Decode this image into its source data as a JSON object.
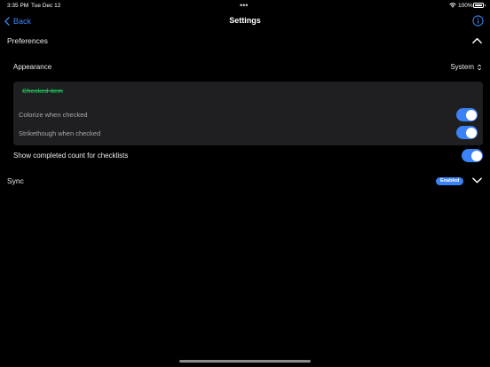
{
  "status_bar": {
    "time": "3:35 PM",
    "date": "Tue Dec 12",
    "battery": "100%"
  },
  "nav": {
    "back_label": "Back",
    "title": "Settings"
  },
  "preferences": {
    "header": "Preferences",
    "appearance_label": "Appearance",
    "appearance_value": "System",
    "preview_text": "Checked item",
    "colorize_label": "Colorize when checked",
    "colorize_on": true,
    "strikethrough_label": "Strikethough when checked",
    "strikethrough_on": true,
    "show_count_label": "Show completed count for checklists",
    "show_count_on": true
  },
  "sync": {
    "header": "Sync",
    "badge": "Enabled"
  },
  "colors": {
    "accent": "#3b82f6",
    "checked_preview": "#22c55e",
    "card_bg": "#1f1f21"
  }
}
